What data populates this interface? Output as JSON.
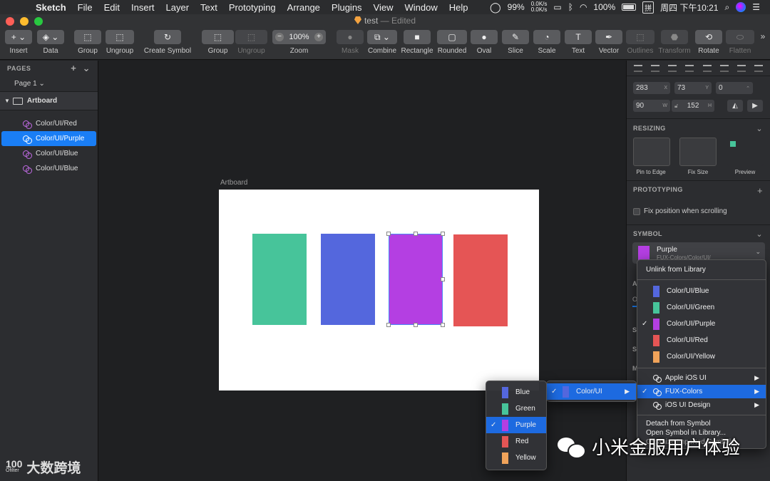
{
  "menubar": {
    "app": "Sketch",
    "items": [
      "File",
      "Edit",
      "Insert",
      "Layer",
      "Text",
      "Prototyping",
      "Arrange",
      "Plugins",
      "View",
      "Window",
      "Help"
    ],
    "cpu": "99%",
    "net_up": "0.0K/s",
    "net_down": "0.0K/s",
    "battery": "100%",
    "ime": "拼",
    "clock": "周四 下午10:21"
  },
  "window": {
    "doc_name": "test",
    "doc_status": "— Edited"
  },
  "toolbar": {
    "insert": "Insert",
    "data": "Data",
    "group": "Group",
    "ungroup": "Ungroup",
    "create_symbol": "Create Symbol",
    "group2": "Group",
    "ungroup2": "Ungroup",
    "zoom": "Zoom",
    "zoom_value": "100%",
    "mask": "Mask",
    "combine": "Combine",
    "rectangle": "Rectangle",
    "rounded": "Rounded",
    "oval": "Oval",
    "slice": "Slice",
    "scale": "Scale",
    "text": "Text",
    "vector": "Vector",
    "outlines": "Outlines",
    "transform": "Transform",
    "rotate": "Rotate",
    "flatten": "Flatten"
  },
  "sidebar": {
    "pages_title": "PAGES",
    "current_page": "Page 1",
    "artboard": "Artboard",
    "layers": [
      "Color/UI/Red",
      "Color/UI/Purple",
      "Color/UI/Blue",
      "Color/UI/Blue"
    ]
  },
  "canvas": {
    "artboard_label": "Artboard"
  },
  "inspector": {
    "x": "283",
    "x_unit": "X",
    "y": "73",
    "y_unit": "Y",
    "rotation": "0",
    "w": "90",
    "w_unit": "W",
    "h": "152",
    "h_unit": "H",
    "resizing_title": "RESIZING",
    "pin_to_edge": "Pin to Edge",
    "fix_size": "Fix Size",
    "preview": "Preview",
    "prototyping_title": "PROTOTYPING",
    "fix_position": "Fix position when scrolling",
    "symbol_title": "SYMBOL",
    "symbol_name": "Purple",
    "symbol_path": "FUX-Colors/Color/UI/",
    "cut_letters": [
      "A",
      "O",
      "S",
      "S",
      "M"
    ]
  },
  "symbol_menu": {
    "unlink": "Unlink from Library",
    "symbols": [
      {
        "label": "Color/UI/Blue",
        "color": "#5467dd"
      },
      {
        "label": "Color/UI/Green",
        "color": "#47c49a"
      },
      {
        "label": "Color/UI/Purple",
        "color": "#b43fe2",
        "checked": true
      },
      {
        "label": "Color/UI/Red",
        "color": "#e55555"
      },
      {
        "label": "Color/UI/Yellow",
        "color": "#f0a35a"
      }
    ],
    "libraries": [
      "Apple iOS UI",
      "FUX-Colors",
      "iOS UI Design"
    ],
    "detach": "Detach from Symbol",
    "open_library": "Open Symbol in Library...",
    "imported": "Organize Imported Symbols..."
  },
  "sub_menu": {
    "label": "Color/UI",
    "color": "#5467dd"
  },
  "color_menu": {
    "items": [
      {
        "label": "Blue",
        "color": "#5467dd"
      },
      {
        "label": "Green",
        "color": "#47c49a"
      },
      {
        "label": "Purple",
        "color": "#b43fe2",
        "checked": true
      },
      {
        "label": "Red",
        "color": "#e55555"
      },
      {
        "label": "Yellow",
        "color": "#f0a35a"
      }
    ]
  },
  "watermark": {
    "left_logo": "100",
    "left_logo_sub": "Ofilter",
    "left_text": "大数跨境",
    "right_text": "小米金服用户体验"
  },
  "colors": {
    "accent": "#1a7ef5",
    "green": "#47c49a",
    "blue": "#5467dd",
    "purple": "#b43fe2",
    "red": "#e55555",
    "yellow": "#f0a35a"
  }
}
